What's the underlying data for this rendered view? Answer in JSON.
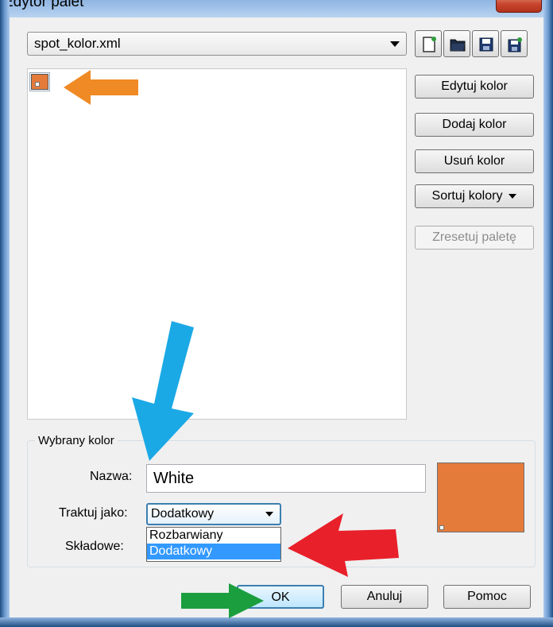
{
  "window": {
    "title": "Edytor palet"
  },
  "palette": {
    "selected_file": "spot_kolor.xml",
    "toolbar_icons": [
      "new-palette-icon",
      "open-palette-icon",
      "save-palette-icon",
      "save-as-palette-icon"
    ]
  },
  "colors": [
    {
      "hex": "#e47b3b",
      "type": "spot"
    }
  ],
  "side_buttons": {
    "edit": "Edytuj kolor",
    "add": "Dodaj kolor",
    "remove": "Usuń kolor",
    "sort": "Sortuj kolory",
    "reset": "Zresetuj paletę"
  },
  "selected_color": {
    "group_label": "Wybrany kolor",
    "name_label": "Nazwa:",
    "name_value": "White",
    "treat_label": "Traktuj jako:",
    "treat_value": "Dodatkowy",
    "treat_options": [
      "Rozbarwiany",
      "Dodatkowy"
    ],
    "components_label": "Składowe:",
    "preview_color": "#e47b3b"
  },
  "bottom_buttons": {
    "ok": "OK",
    "cancel": "Anuluj",
    "help": "Pomoc"
  },
  "annotation_colors": {
    "orange": "#f08a24",
    "blue": "#1ba9e6",
    "red": "#e8202a",
    "green": "#1b9e3e"
  }
}
